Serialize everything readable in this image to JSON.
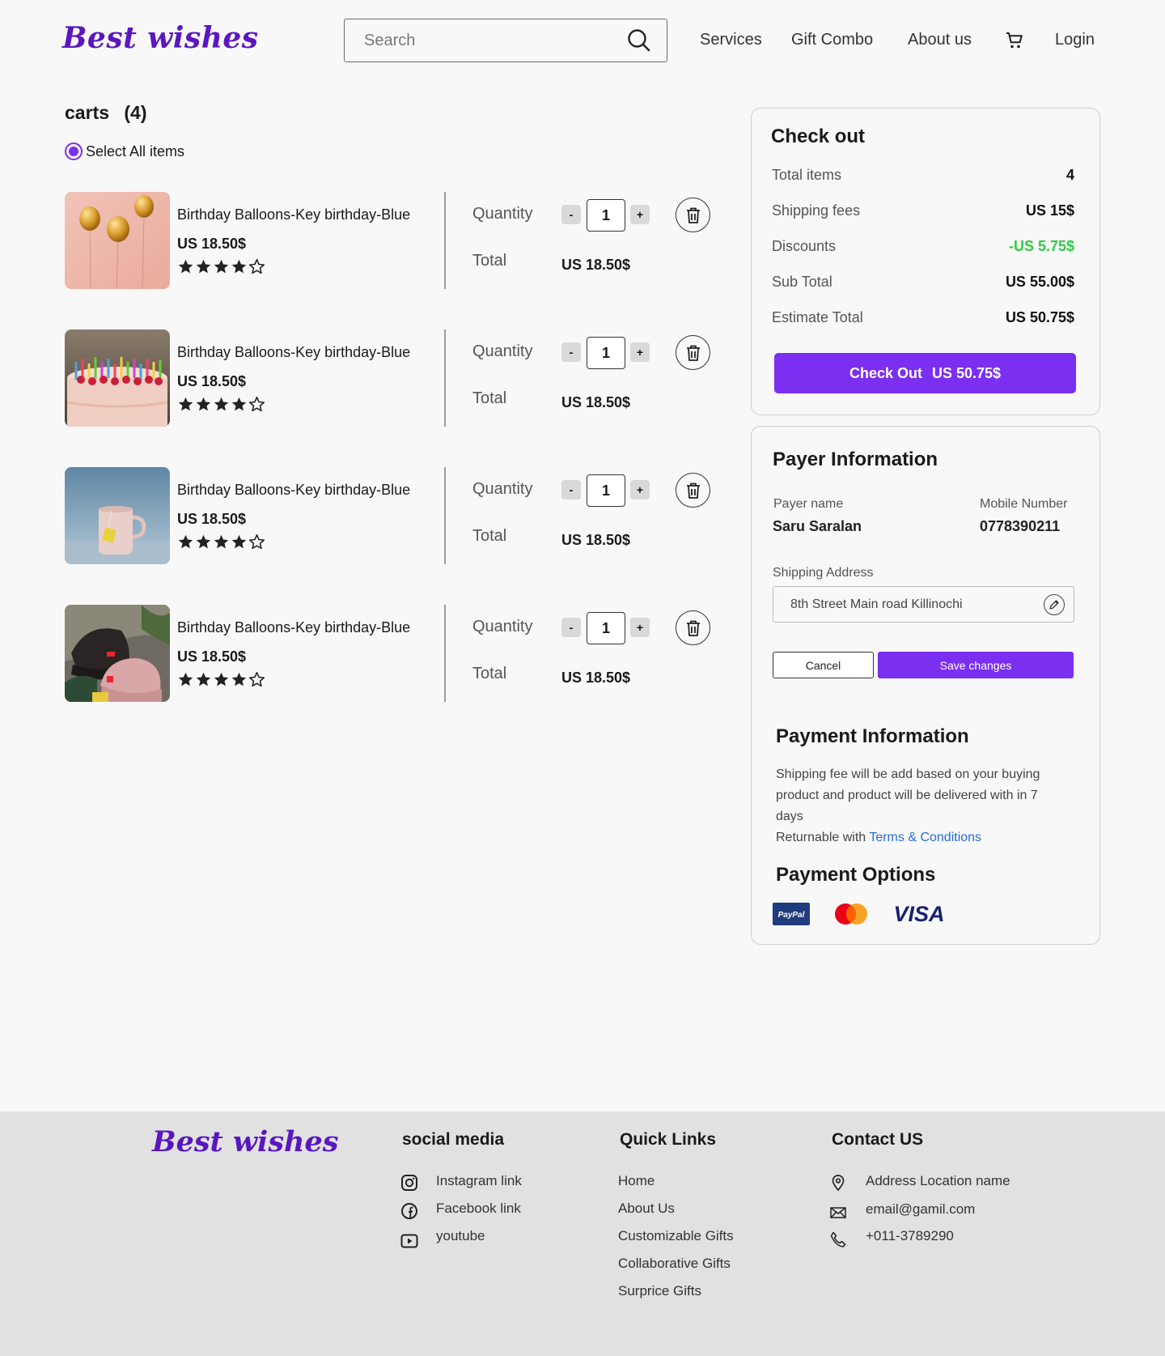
{
  "header": {
    "logo": "Best wishes",
    "search_placeholder": "Search",
    "nav": [
      "Services",
      "Gift Combo",
      "About us"
    ],
    "login": "Login"
  },
  "cart": {
    "title": "carts",
    "count": "(4)",
    "select_all": "Select All items",
    "quantity_label": "Quantity",
    "total_label": "Total",
    "minus": "-",
    "plus": "+",
    "items": [
      {
        "name": "Birthday Balloons-Key birthday-Blue",
        "price": "US 18.50$",
        "rating": 4,
        "quantity": "1",
        "total": "US 18.50$",
        "image": "golden-balloons"
      },
      {
        "name": "Birthday Balloons-Key birthday-Blue",
        "price": "US 18.50$",
        "rating": 4,
        "quantity": "1",
        "total": "US 18.50$",
        "image": "birthday-cake"
      },
      {
        "name": "Birthday Balloons-Key birthday-Blue",
        "price": "US 18.50$",
        "rating": 4,
        "quantity": "1",
        "total": "US 18.50$",
        "image": "tea-mug"
      },
      {
        "name": "Birthday Balloons-Key birthday-Blue",
        "price": "US 18.50$",
        "rating": 4,
        "quantity": "1",
        "total": "US 18.50$",
        "image": "beanie-hats"
      }
    ]
  },
  "checkout": {
    "title": "Check out",
    "rows": [
      {
        "label": "Total items",
        "value": "4"
      },
      {
        "label": "Shipping fees",
        "value": "US 15$"
      },
      {
        "label": "Discounts",
        "value": "-US 5.75$"
      },
      {
        "label": "Sub Total",
        "value": "US 55.00$"
      },
      {
        "label": "Estimate Total",
        "value": "US 50.75$"
      }
    ],
    "button_label": "Check Out",
    "button_amount": "US 50.75$",
    "discount_color": "#2ecc40"
  },
  "payer": {
    "title": "Payer Information",
    "name_label": "Payer name",
    "name": "Saru Saralan",
    "mobile_label": "Mobile Number",
    "mobile": "0778390211",
    "address_label": "Shipping Address",
    "address": "8th Street Main road Killinochi",
    "cancel": "Cancel",
    "save": "Save changes"
  },
  "payment": {
    "info_title": "Payment Information",
    "info_text": "Shipping fee will be add based on your buying product and product will be delivered with in 7 days",
    "returnable_text": "Returnable with",
    "terms_link": "Terms & Conditions",
    "options_title": "Payment Options",
    "options": [
      "PayPal",
      "Mastercard",
      "VISA"
    ]
  },
  "footer": {
    "logo": "Best wishes",
    "social_title": "social media",
    "social": [
      {
        "label": "Instagram link",
        "icon": "instagram-icon"
      },
      {
        "label": "Facebook link",
        "icon": "facebook-icon"
      },
      {
        "label": "youtube",
        "icon": "youtube-icon"
      }
    ],
    "quick_title": "Quick Links",
    "quick": [
      "Home",
      "About Us",
      "Customizable Gifts",
      "Collaborative Gifts",
      "Surprice Gifts"
    ],
    "contact_title": "Contact US",
    "contact": [
      {
        "label": "Address Location name",
        "icon": "location-pin-icon"
      },
      {
        "label": "email@gamil.com",
        "icon": "mail-icon"
      },
      {
        "label": "+011-3789290",
        "icon": "phone-icon"
      }
    ]
  },
  "colors": {
    "accent": "#7b2ff0",
    "logo": "#5a17c0",
    "background": "#f8f8f8",
    "footer_background": "#e1e1e1",
    "link": "#2a6dd4"
  }
}
